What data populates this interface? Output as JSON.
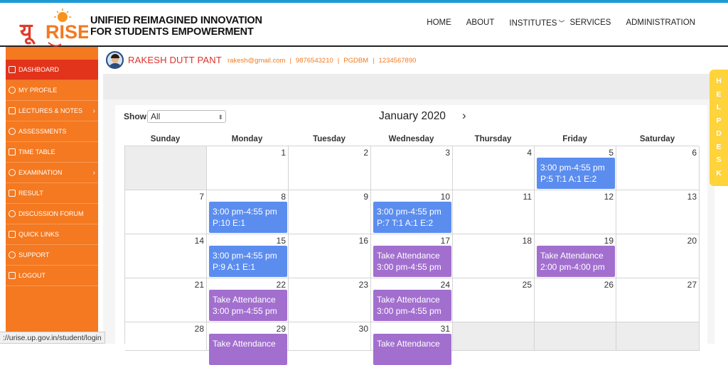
{
  "brand": {
    "logo_text": "यूRISE",
    "title_line1": "UNIFIED REIMAGINED INNOVATION",
    "title_line2": "FOR STUDENTS EMPOWERMENT"
  },
  "nav": [
    "HOME",
    "ABOUT",
    "INSTITUTES",
    "SERVICES",
    "ADMINISTRATION"
  ],
  "sidebar": {
    "items": [
      {
        "label": "DASHBOARD",
        "icon": "dashboard-icon",
        "active": true
      },
      {
        "label": "MY PROFILE",
        "icon": "profile-icon"
      },
      {
        "label": "LECTURES & NOTES",
        "icon": "notes-icon",
        "submenu": true
      },
      {
        "label": "ASSESSMENTS",
        "icon": "tools-icon"
      },
      {
        "label": "TIME TABLE",
        "icon": "calendar-icon"
      },
      {
        "label": "EXAMINATION",
        "icon": "exam-icon",
        "submenu": true
      },
      {
        "label": "RESULT",
        "icon": "result-icon"
      },
      {
        "label": "DISCUSSION FORUM",
        "icon": "chat-icon"
      },
      {
        "label": "QUICK LINKS",
        "icon": "refresh-icon"
      },
      {
        "label": "SUPPORT",
        "icon": "support-icon"
      },
      {
        "label": "LOGOUT",
        "icon": "power-icon"
      }
    ]
  },
  "profile": {
    "name": "RAKESH DUTT PANT",
    "email": "rakesh@gmail.com",
    "phone": "9876543210",
    "course": "PGDBM",
    "id": "1234567890"
  },
  "helpdesk": [
    "H",
    "E",
    "L",
    "P",
    "D",
    "E",
    "S",
    "K"
  ],
  "calendar": {
    "show_label": "Show",
    "show_value": "All",
    "month_title": "January 2020",
    "next_symbol": "›",
    "weekdays": [
      "Sunday",
      "Monday",
      "Tuesday",
      "Wednesday",
      "Thursday",
      "Friday",
      "Saturday"
    ],
    "weeks": [
      [
        {
          "day": "",
          "dim": true
        },
        {
          "day": "1"
        },
        {
          "day": "2"
        },
        {
          "day": "3"
        },
        {
          "day": "4"
        },
        {
          "day": "5",
          "event": {
            "color": "blue",
            "line1": "3:00 pm-4:55 pm",
            "line2": "P:5 T:1 A:1 E:2"
          }
        },
        {
          "day": "6"
        }
      ],
      [
        {
          "day": "7"
        },
        {
          "day": "8",
          "event": {
            "color": "blue",
            "line1": "3:00 pm-4:55 pm",
            "line2": "P:10 E:1"
          }
        },
        {
          "day": "9"
        },
        {
          "day": "10",
          "event": {
            "color": "blue",
            "line1": "3:00 pm-4:55 pm",
            "line2": "P:7 T:1 A:1 E:2"
          }
        },
        {
          "day": "11"
        },
        {
          "day": "12"
        },
        {
          "day": "13"
        }
      ],
      [
        {
          "day": "14"
        },
        {
          "day": "15",
          "event": {
            "color": "blue",
            "line1": "3:00 pm-4:55 pm",
            "line2": "P:9 A:1 E:1"
          }
        },
        {
          "day": "16"
        },
        {
          "day": "17",
          "event": {
            "color": "purple",
            "line1": "Take Attendance",
            "line2": "3:00 pm-4:55 pm"
          }
        },
        {
          "day": "18"
        },
        {
          "day": "19",
          "event": {
            "color": "purple",
            "line1": "Take Attendance",
            "line2": "2:00 pm-4:00 pm"
          }
        },
        {
          "day": "20"
        }
      ],
      [
        {
          "day": "21"
        },
        {
          "day": "22",
          "event": {
            "color": "purple",
            "line1": "Take Attendance",
            "line2": "3:00 pm-4:55 pm"
          }
        },
        {
          "day": "23"
        },
        {
          "day": "24",
          "event": {
            "color": "purple",
            "line1": "Take Attendance",
            "line2": "3:00 pm-4:55 pm"
          }
        },
        {
          "day": "25"
        },
        {
          "day": "26"
        },
        {
          "day": "27"
        }
      ],
      [
        {
          "day": "28"
        },
        {
          "day": "29",
          "event": {
            "color": "purple",
            "line1": "Take Attendance",
            "line2": ""
          }
        },
        {
          "day": "30"
        },
        {
          "day": "31",
          "event": {
            "color": "purple",
            "line1": "Take Attendance",
            "line2": ""
          }
        },
        {
          "day": "",
          "dim": true
        },
        {
          "day": "",
          "dim": true
        },
        {
          "day": "",
          "dim": true
        }
      ]
    ]
  },
  "status_url": "://urise.up.gov.in/student/login",
  "colors": {
    "orange": "#f47920",
    "active_red": "#e2331b",
    "event_blue": "#5b8def",
    "event_purple": "#a26fcf",
    "helpdesk_yellow": "#fed33b"
  }
}
